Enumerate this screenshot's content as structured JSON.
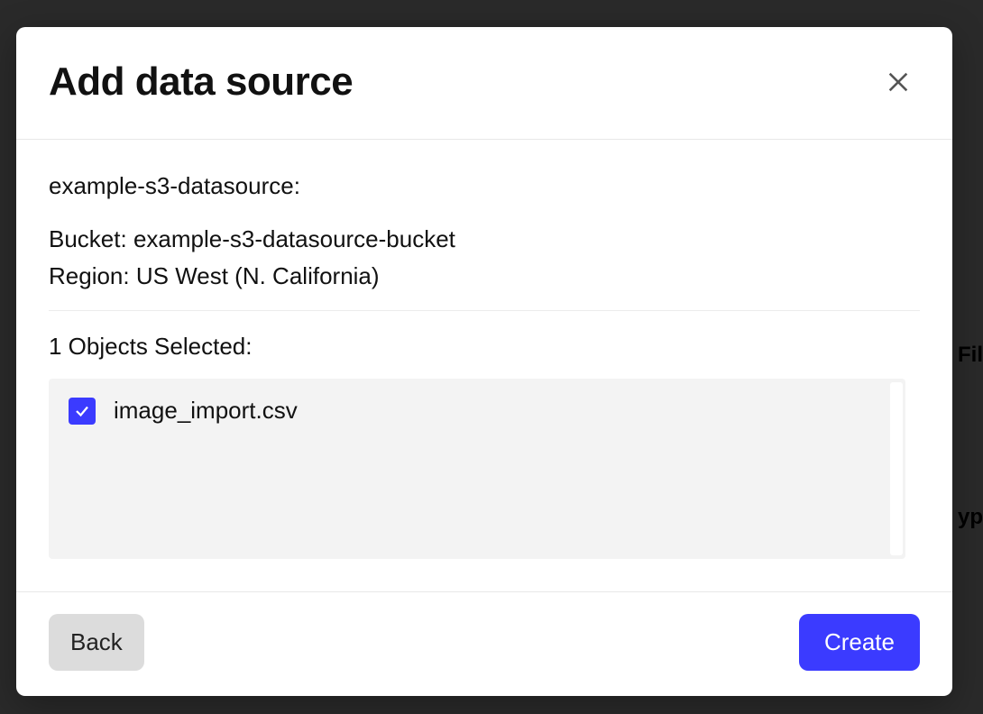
{
  "modal": {
    "title": "Add data source",
    "datasource_name": "example-s3-datasource:",
    "bucket_label": "Bucket:",
    "bucket_value": "example-s3-datasource-bucket",
    "region_label": "Region:",
    "region_value": "US West (N. California)",
    "selected_label": "1 Objects Selected:",
    "objects": [
      {
        "name": "image_import.csv",
        "checked": true
      }
    ],
    "back_label": "Back",
    "create_label": "Create"
  },
  "background": {
    "frag1": "Fil",
    "frag2": "yp"
  }
}
